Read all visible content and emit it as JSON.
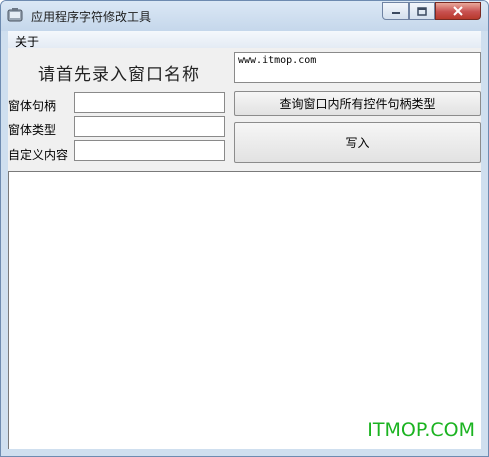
{
  "window": {
    "title": "应用程序字符修改工具",
    "menu_about": "关于"
  },
  "form": {
    "heading": "请首先录入窗口名称",
    "window_name_value": "www.itmop.com",
    "handle_label": "窗体句柄",
    "handle_value": "",
    "type_label": "窗体类型",
    "type_value": "",
    "custom_label": "自定义内容",
    "custom_value": "",
    "query_button": "查询窗口内所有控件句柄类型",
    "write_button": "写入"
  },
  "output": {
    "log_text": ""
  },
  "watermark": "ITMOP.COM"
}
